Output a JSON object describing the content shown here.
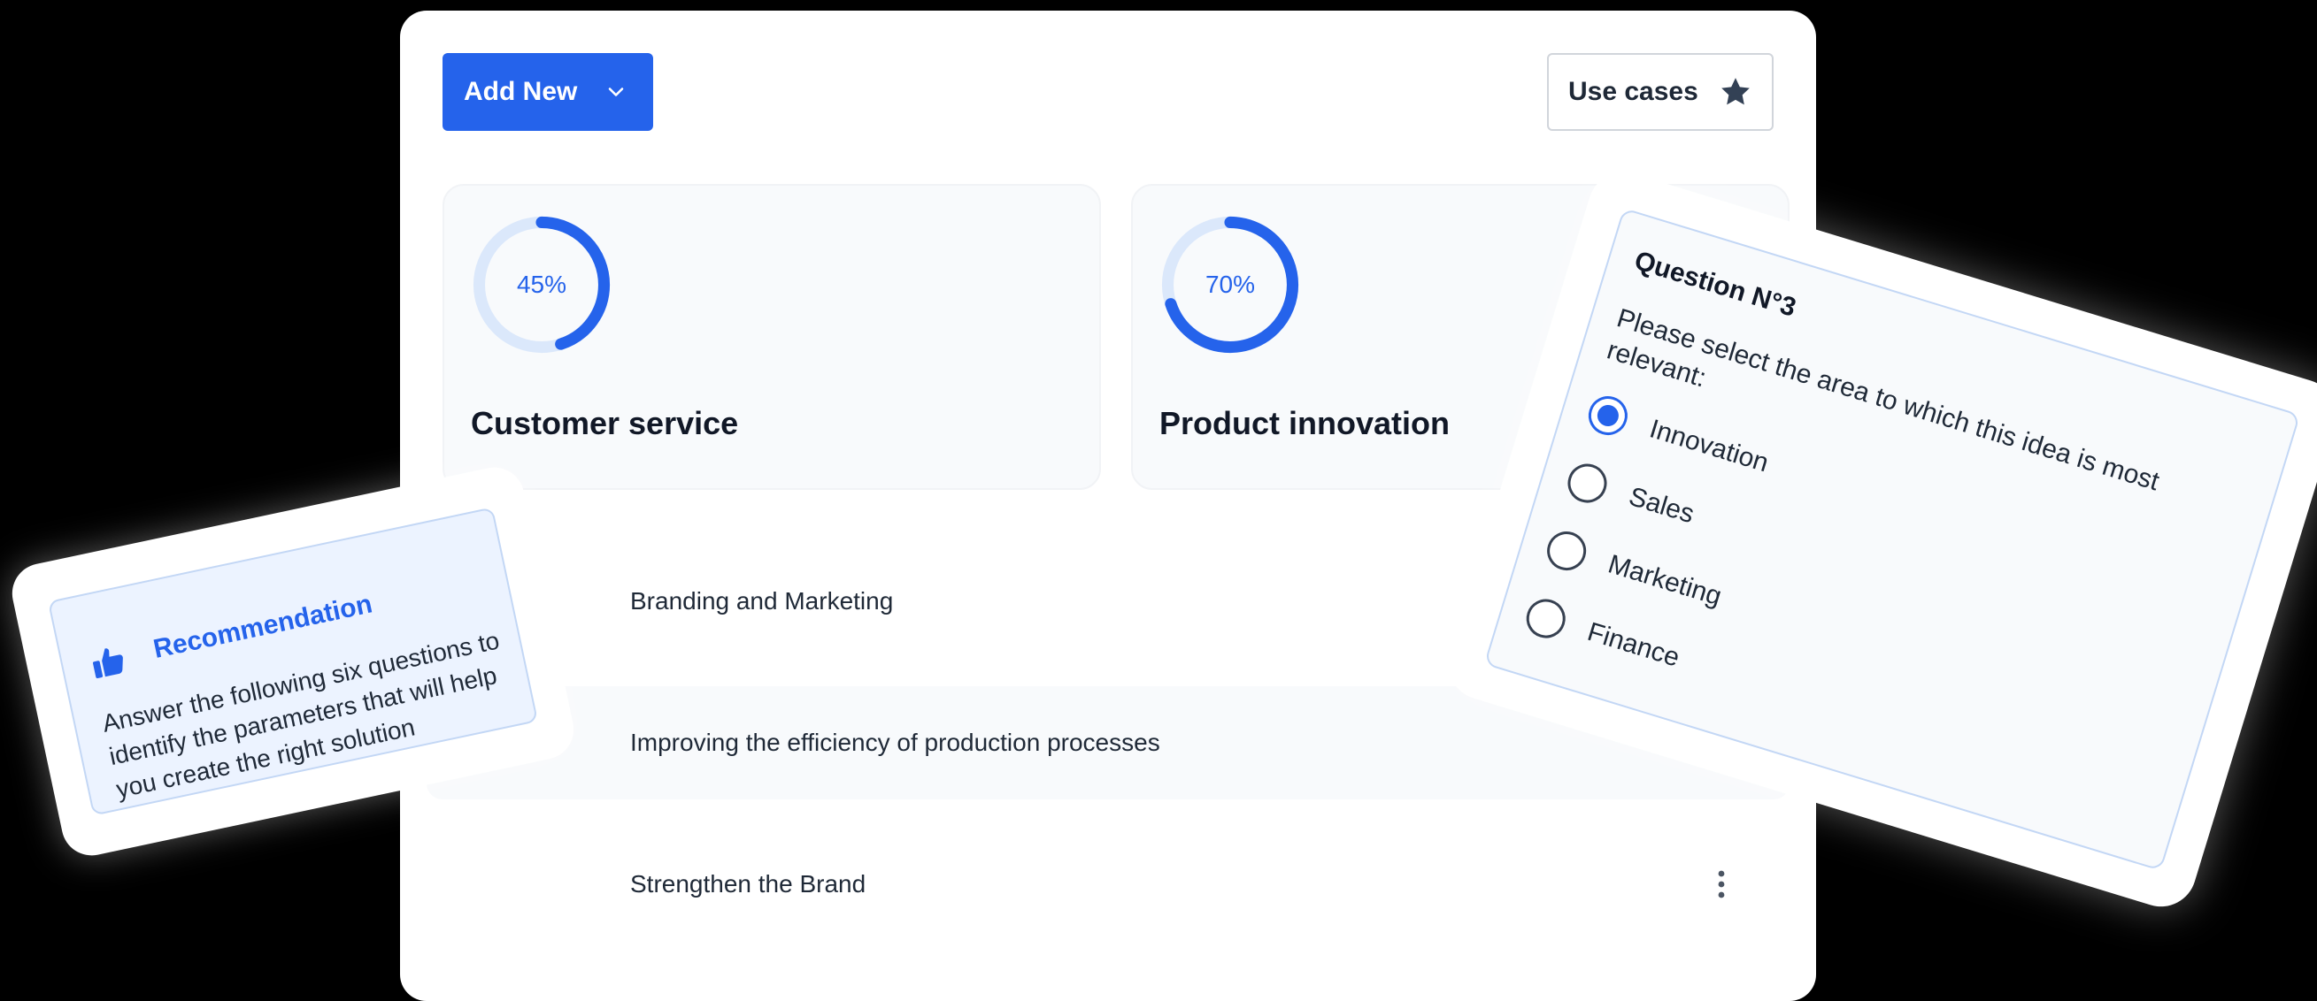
{
  "toolbar": {
    "add_new_label": "Add New",
    "use_cases_label": "Use cases"
  },
  "stats": [
    {
      "percent_label": "45%",
      "percent": 45,
      "title": "Customer service"
    },
    {
      "percent_label": "70%",
      "percent": 70,
      "title": "Product innovation"
    }
  ],
  "list": [
    {
      "label": "Branding and Marketing"
    },
    {
      "label": "Improving the efficiency of production processes"
    },
    {
      "label": "Strengthen the Brand"
    }
  ],
  "recommendation": {
    "icon": "thumbs-up-icon",
    "title": "Recommendation",
    "body": "Answer the following six questions to identify the parameters that will help you create the right solution"
  },
  "question": {
    "title": "Question N°3",
    "prompt": "Please select the area to which this idea is most relevant:",
    "options": [
      {
        "label": "Innovation",
        "selected": true
      },
      {
        "label": "Sales",
        "selected": false
      },
      {
        "label": "Marketing",
        "selected": false
      },
      {
        "label": "Finance",
        "selected": false
      }
    ]
  },
  "colors": {
    "accent": "#2563eb",
    "track": "#dbe8fb",
    "background": "#000000"
  }
}
